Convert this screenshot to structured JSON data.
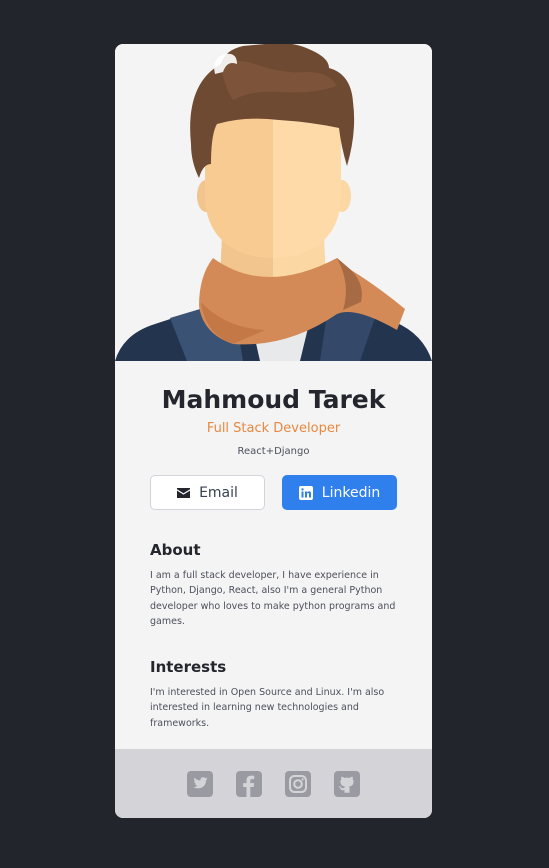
{
  "profile": {
    "name": "Mahmoud Tarek",
    "role": "Full Stack Developer",
    "stack": "React+Django"
  },
  "buttons": {
    "email_label": "Email",
    "email_icon": "envelope-icon",
    "linkedin_label": "Linkedin",
    "linkedin_icon": "linkedin-icon"
  },
  "about": {
    "title": "About",
    "text": "I am a full stack developer, I have experience in Python, Django, React, also I'm a general Python developer who loves to make python programs and games."
  },
  "interests": {
    "title": "Interests",
    "text": "I'm interested in Open Source and Linux. I'm also interested in learning new technologies and frameworks."
  },
  "social": [
    "twitter-icon",
    "facebook-icon",
    "instagram-icon",
    "github-icon"
  ],
  "colors": {
    "page_bg": "#23252c",
    "card_bg": "#f4f4f4",
    "accent": "#e8883f",
    "linkedin_blue": "#2f80ed",
    "footer_bg": "#d4d4d8",
    "footer_icon": "#9a9aa2"
  }
}
